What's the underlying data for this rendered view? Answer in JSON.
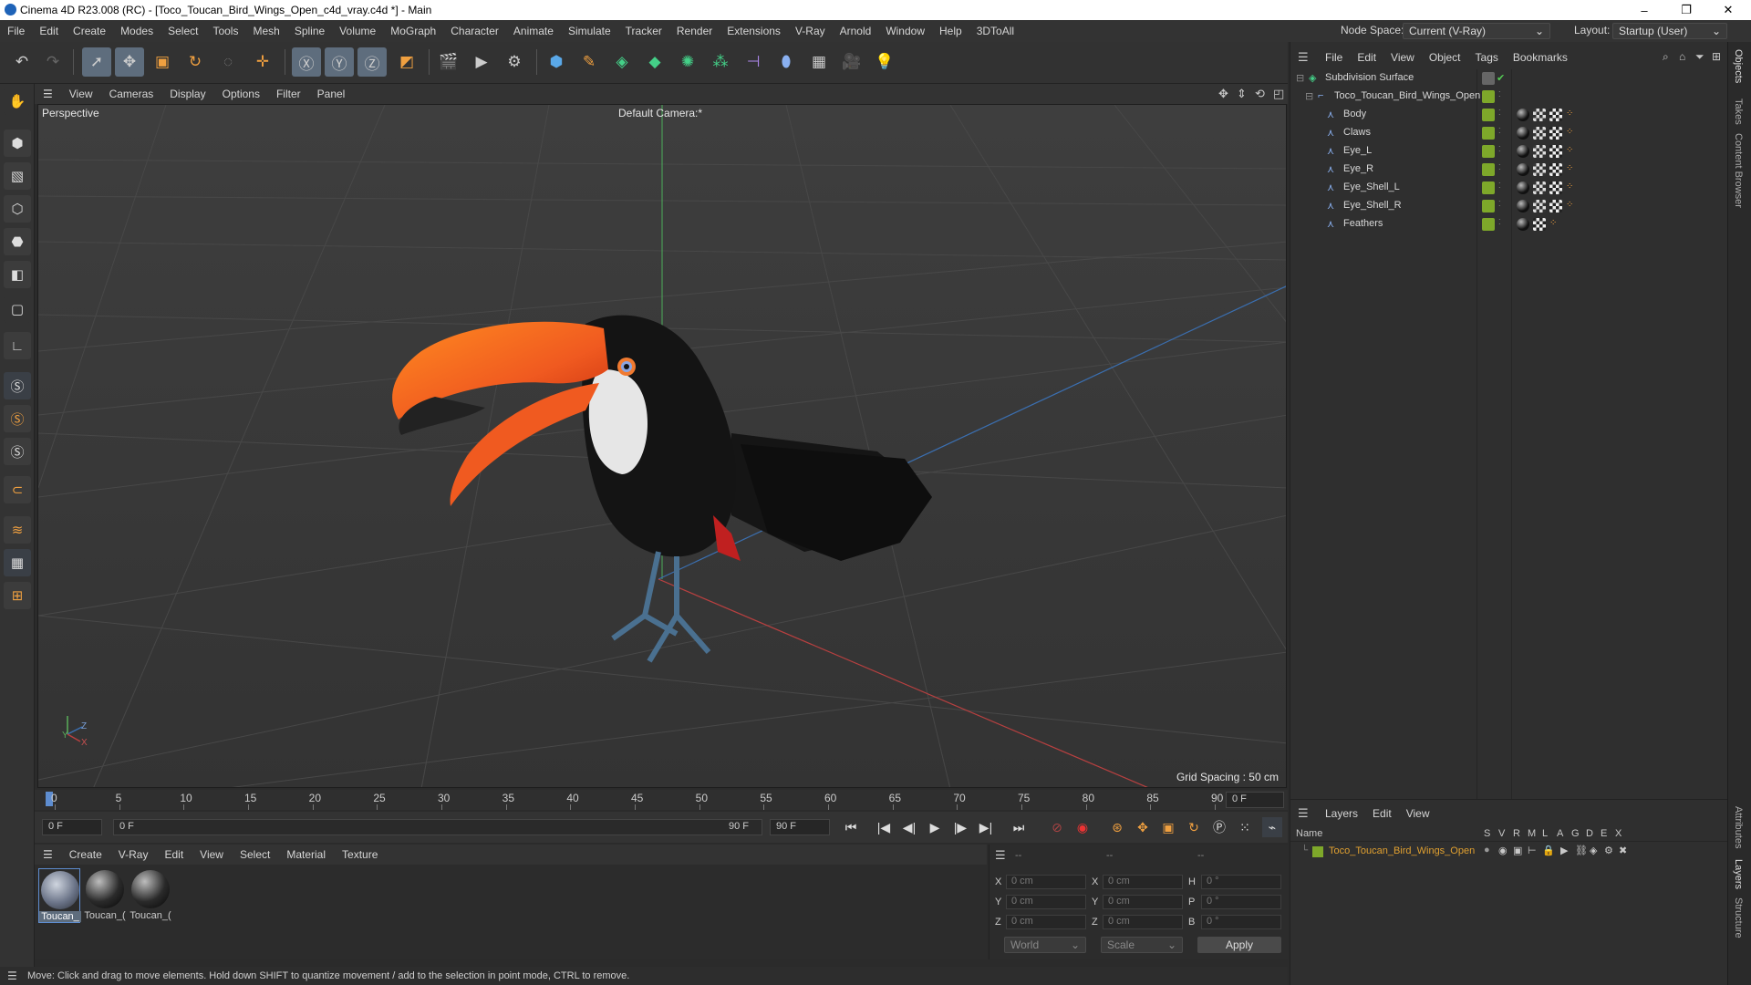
{
  "window": {
    "title": "Cinema 4D R23.008 (RC) - [Toco_Toucan_Bird_Wings_Open_c4d_vray.c4d *] - Main",
    "minimize": "–",
    "maximize": "❐",
    "close": "✕"
  },
  "menubar": {
    "items": [
      "File",
      "Edit",
      "Create",
      "Modes",
      "Select",
      "Tools",
      "Mesh",
      "Spline",
      "Volume",
      "MoGraph",
      "Character",
      "Animate",
      "Simulate",
      "Tracker",
      "Render",
      "Extensions",
      "V-Ray",
      "Arnold",
      "Window",
      "Help",
      "3DToAll"
    ],
    "node_space_label": "Node Space:",
    "node_space_value": "Current (V-Ray)",
    "layout_label": "Layout:",
    "layout_value": "Startup (User)"
  },
  "viewport": {
    "menu": [
      "View",
      "Cameras",
      "Display",
      "Options",
      "Filter",
      "Panel"
    ],
    "view_name": "Perspective",
    "camera": "Default Camera",
    "camera_marker": ":*",
    "grid_spacing": "Grid Spacing : 50 cm",
    "axis_y": "Y",
    "axis_z": "Z",
    "axis_x": "X"
  },
  "timeline": {
    "ticks": [
      "0",
      "5",
      "10",
      "15",
      "20",
      "25",
      "30",
      "35",
      "40",
      "45",
      "50",
      "55",
      "60",
      "65",
      "70",
      "75",
      "80",
      "85",
      "90"
    ],
    "current_frame_field": "0 F",
    "start_field": "0 F",
    "range_start": "0 F",
    "range_end": "90 F",
    "end_field": "90 F"
  },
  "transport": {
    "go_start": "⏮",
    "prev_key": "|◀",
    "prev_frame": "◀|",
    "play": "▶",
    "next_frame": "|▶",
    "next_key": "▶|",
    "go_end": "⏭"
  },
  "materials": {
    "menu": [
      "Create",
      "V-Ray",
      "Edit",
      "View",
      "Select",
      "Material",
      "Texture"
    ],
    "items": [
      {
        "label": "Toucan_"
      },
      {
        "label": "Toucan_("
      },
      {
        "label": "Toucan_("
      }
    ]
  },
  "coordinates": {
    "header": [
      "--",
      "--",
      "--"
    ],
    "rows": [
      {
        "a": "X",
        "av": "0 cm",
        "b": "X",
        "bv": "0 cm",
        "c": "H",
        "cv": "0 °"
      },
      {
        "a": "Y",
        "av": "0 cm",
        "b": "Y",
        "bv": "0 cm",
        "c": "P",
        "cv": "0 °"
      },
      {
        "a": "Z",
        "av": "0 cm",
        "b": "Z",
        "bv": "0 cm",
        "c": "B",
        "cv": "0 °"
      }
    ],
    "mode": "World",
    "transform": "Scale",
    "apply": "Apply"
  },
  "statusbar": {
    "text": "Move: Click and drag to move elements. Hold down SHIFT to quantize movement / add to the selection in point mode, CTRL to remove."
  },
  "objects": {
    "menu": [
      "File",
      "Edit",
      "View",
      "Object",
      "Tags",
      "Bookmarks"
    ],
    "items": [
      {
        "name": "Subdivision Surface",
        "indent": 0
      },
      {
        "name": "Toco_Toucan_Bird_Wings_Open",
        "indent": 1
      },
      {
        "name": "Body",
        "indent": 2
      },
      {
        "name": "Claws",
        "indent": 2
      },
      {
        "name": "Eye_L",
        "indent": 2
      },
      {
        "name": "Eye_R",
        "indent": 2
      },
      {
        "name": "Eye_Shell_L",
        "indent": 2
      },
      {
        "name": "Eye_Shell_R",
        "indent": 2
      },
      {
        "name": "Feathers",
        "indent": 2
      }
    ]
  },
  "layers": {
    "menu": [
      "Layers",
      "Edit",
      "View"
    ],
    "columns": [
      "Name",
      "S",
      "V",
      "R",
      "M",
      "L",
      "A",
      "G",
      "D",
      "E",
      "X"
    ],
    "items": [
      {
        "name": "Toco_Toucan_Bird_Wings_Open",
        "color": "#7ea82a"
      }
    ]
  },
  "right_tabs": [
    "Objects",
    "Takes",
    "Content Browser",
    "Attributes",
    "Layers",
    "Structure"
  ],
  "colors": {
    "accent": "#5e6d7d",
    "layer_name": "#e0a030",
    "tag_green": "#7ea82a"
  }
}
